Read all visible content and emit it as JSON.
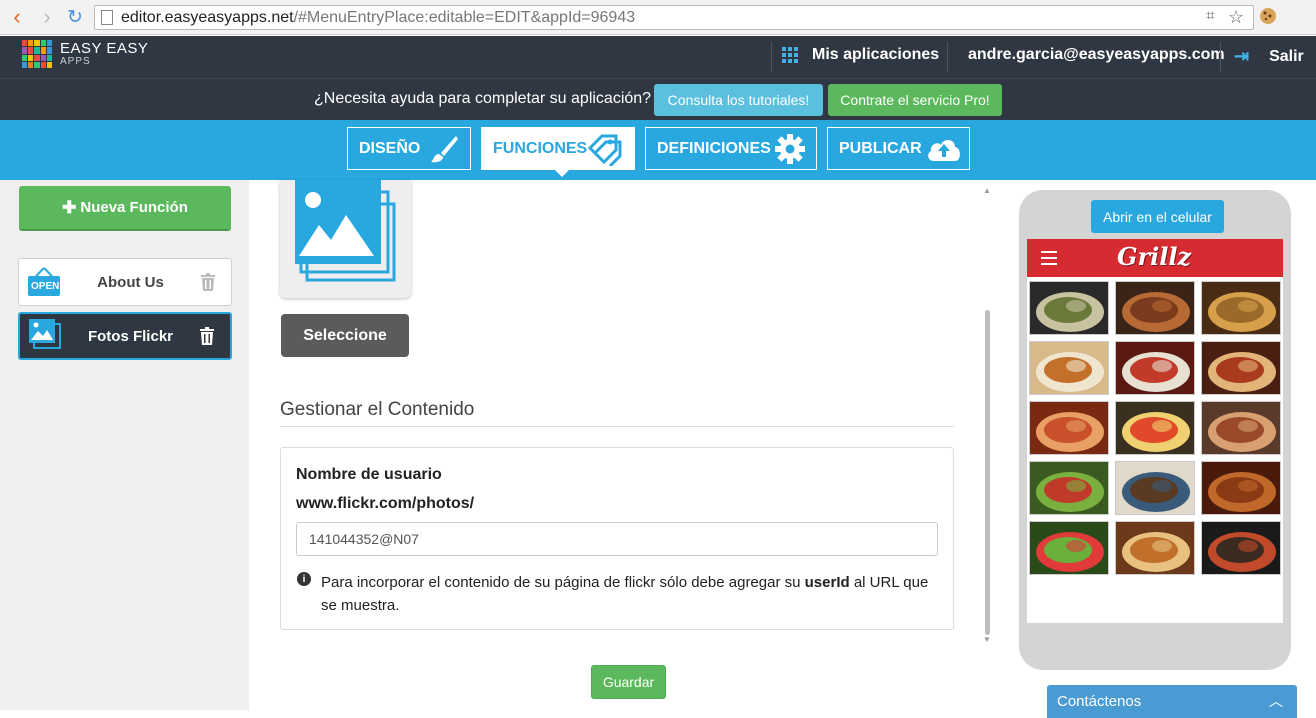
{
  "browser": {
    "url_host": "editor.easyeasyapps.net",
    "url_rest": "/#MenuEntryPlace:editable=EDIT&appId=96943"
  },
  "header": {
    "logo_line1": "EASY EASY",
    "logo_line2": "APPS",
    "my_apps": "Mis aplicaciones",
    "user_email": "andre.garcia@easyeasyapps.com",
    "logout": "Salir"
  },
  "help": {
    "question": "¿Necesita ayuda para completar su aplicación?",
    "tutorials_btn": "Consulta los tutoriales!",
    "pro_btn": "Contrate el servicio Pro!"
  },
  "tabs": [
    {
      "label": "DISEÑO",
      "icon": "brush-icon"
    },
    {
      "label": "FUNCIONES",
      "icon": "tag-icon",
      "active": true
    },
    {
      "label": "DEFINICIONES",
      "icon": "gear-icon"
    },
    {
      "label": "PUBLICAR",
      "icon": "cloud-upload-icon"
    }
  ],
  "sidebar": {
    "new_function": "Nueva Función",
    "items": [
      {
        "label": "About Us",
        "icon": "open-sign-icon",
        "badge": "OPEN"
      },
      {
        "label": "Fotos Flickr",
        "icon": "photos-icon",
        "selected": true
      }
    ]
  },
  "main": {
    "select_btn": "Seleccione",
    "section_title": "Gestionar el Contenido",
    "username_label": "Nombre de usuario",
    "url_prefix": "www.flickr.com/photos/",
    "username_value": "141044352@N07",
    "info_before": "Para incorporar el contenido de su página de flickr sólo debe agregar su ",
    "info_bold": "userId",
    "info_after": " al URL que se muestra.",
    "save_btn": "Guardar"
  },
  "phone": {
    "open_btn": "Abrir en el celular",
    "app_title": "Grillz",
    "thumbnails": 15
  },
  "contact": {
    "label": "Contáctenos"
  },
  "colors": {
    "header_bg": "#2f3742",
    "accent_blue": "#29a8e0",
    "green": "#5cb85c",
    "app_red": "#d52b31"
  }
}
